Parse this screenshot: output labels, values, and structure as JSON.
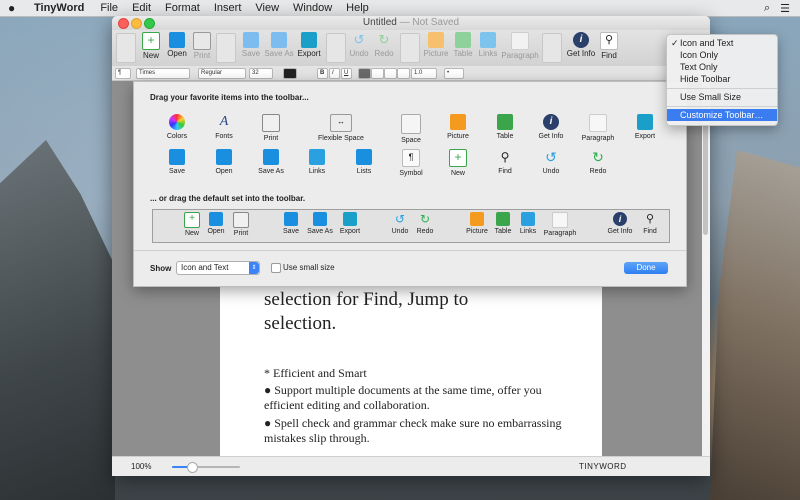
{
  "menubar": {
    "app_name": "TinyWord",
    "menus": [
      "File",
      "Edit",
      "Format",
      "Insert",
      "View",
      "Window",
      "Help"
    ]
  },
  "window": {
    "title": "Untitled",
    "title_state": "— Not Saved"
  },
  "toolbar": {
    "items": [
      {
        "label": "New",
        "icon": "new-icon",
        "color": "#3aa54a"
      },
      {
        "label": "Open",
        "icon": "folder-icon",
        "color": "#1a8fe0"
      },
      {
        "label": "Print",
        "icon": "printer-icon",
        "color": "#9a9a9a"
      },
      {
        "label": "Save",
        "icon": "save-icon",
        "color": "#1a8fe0"
      },
      {
        "label": "Save As",
        "icon": "save-as-icon",
        "color": "#1a8fe0"
      },
      {
        "label": "Export",
        "icon": "export-icon",
        "color": "#1aa0c8"
      },
      {
        "label": "Undo",
        "icon": "undo-icon",
        "color": "#2aa0e0"
      },
      {
        "label": "Redo",
        "icon": "redo-icon",
        "color": "#2ab050"
      },
      {
        "label": "Picture",
        "icon": "picture-icon",
        "color": "#f39a1f"
      },
      {
        "label": "Table",
        "icon": "table-icon",
        "color": "#3aa54a"
      },
      {
        "label": "Links",
        "icon": "links-icon",
        "color": "#2aa0e0"
      },
      {
        "label": "Paragraph",
        "icon": "paragraph-icon",
        "color": "#d9d9d9"
      },
      {
        "label": "Get Info",
        "icon": "info-icon",
        "color": "#2a3f6a"
      },
      {
        "label": "Find",
        "icon": "magnifier-icon",
        "color": "#ffffff"
      }
    ]
  },
  "formatbar": {
    "paragraph_style": "¶",
    "font_family": "Times",
    "font_style": "Regular",
    "font_size": "32",
    "text_color": "#222222",
    "buttons": [
      "B",
      "I",
      "U"
    ],
    "line_spacing": "1.0",
    "list_style": "•"
  },
  "document": {
    "line1": "selection for Find, Jump to",
    "line2": "selection.",
    "bullet_heading": "* Efficient and Smart",
    "bullet1": "● Support multiple documents at the same time, offer you efficient editing and collaboration.",
    "bullet2": "● Spell check and grammar check make sure no embarrassing mistakes slip through."
  },
  "statusbar": {
    "zoom": "100%",
    "zoom_fraction": 0.3,
    "app_label": "TINYWORD"
  },
  "customize_sheet": {
    "heading": "Drag your favorite items into the toolbar...",
    "palette_row1": [
      "Colors",
      "Fonts",
      "Print",
      "Flexible Space",
      "Space",
      "Picture",
      "Table",
      "Get Info",
      "Paragraph",
      "Export"
    ],
    "palette_row2": [
      "Save",
      "Open",
      "Save As",
      "Links",
      "Lists",
      "Symbol",
      "New",
      "Find",
      "Undo",
      "Redo"
    ],
    "default_heading": "... or drag the default set into the toolbar.",
    "default_set": [
      "New",
      "Open",
      "Print",
      "Save",
      "Save As",
      "Export",
      "Undo",
      "Redo",
      "Picture",
      "Table",
      "Links",
      "Paragraph",
      "Get Info",
      "Find"
    ],
    "show_label": "Show",
    "show_value": "Icon and Text",
    "small_size_label": "Use small size",
    "done_label": "Done"
  },
  "context_menu": {
    "items": [
      "Icon and Text",
      "Icon Only",
      "Text Only",
      "Hide Toolbar"
    ],
    "checked": "✓",
    "small_size": "Use Small Size",
    "customize": "Customize Toolbar…"
  }
}
